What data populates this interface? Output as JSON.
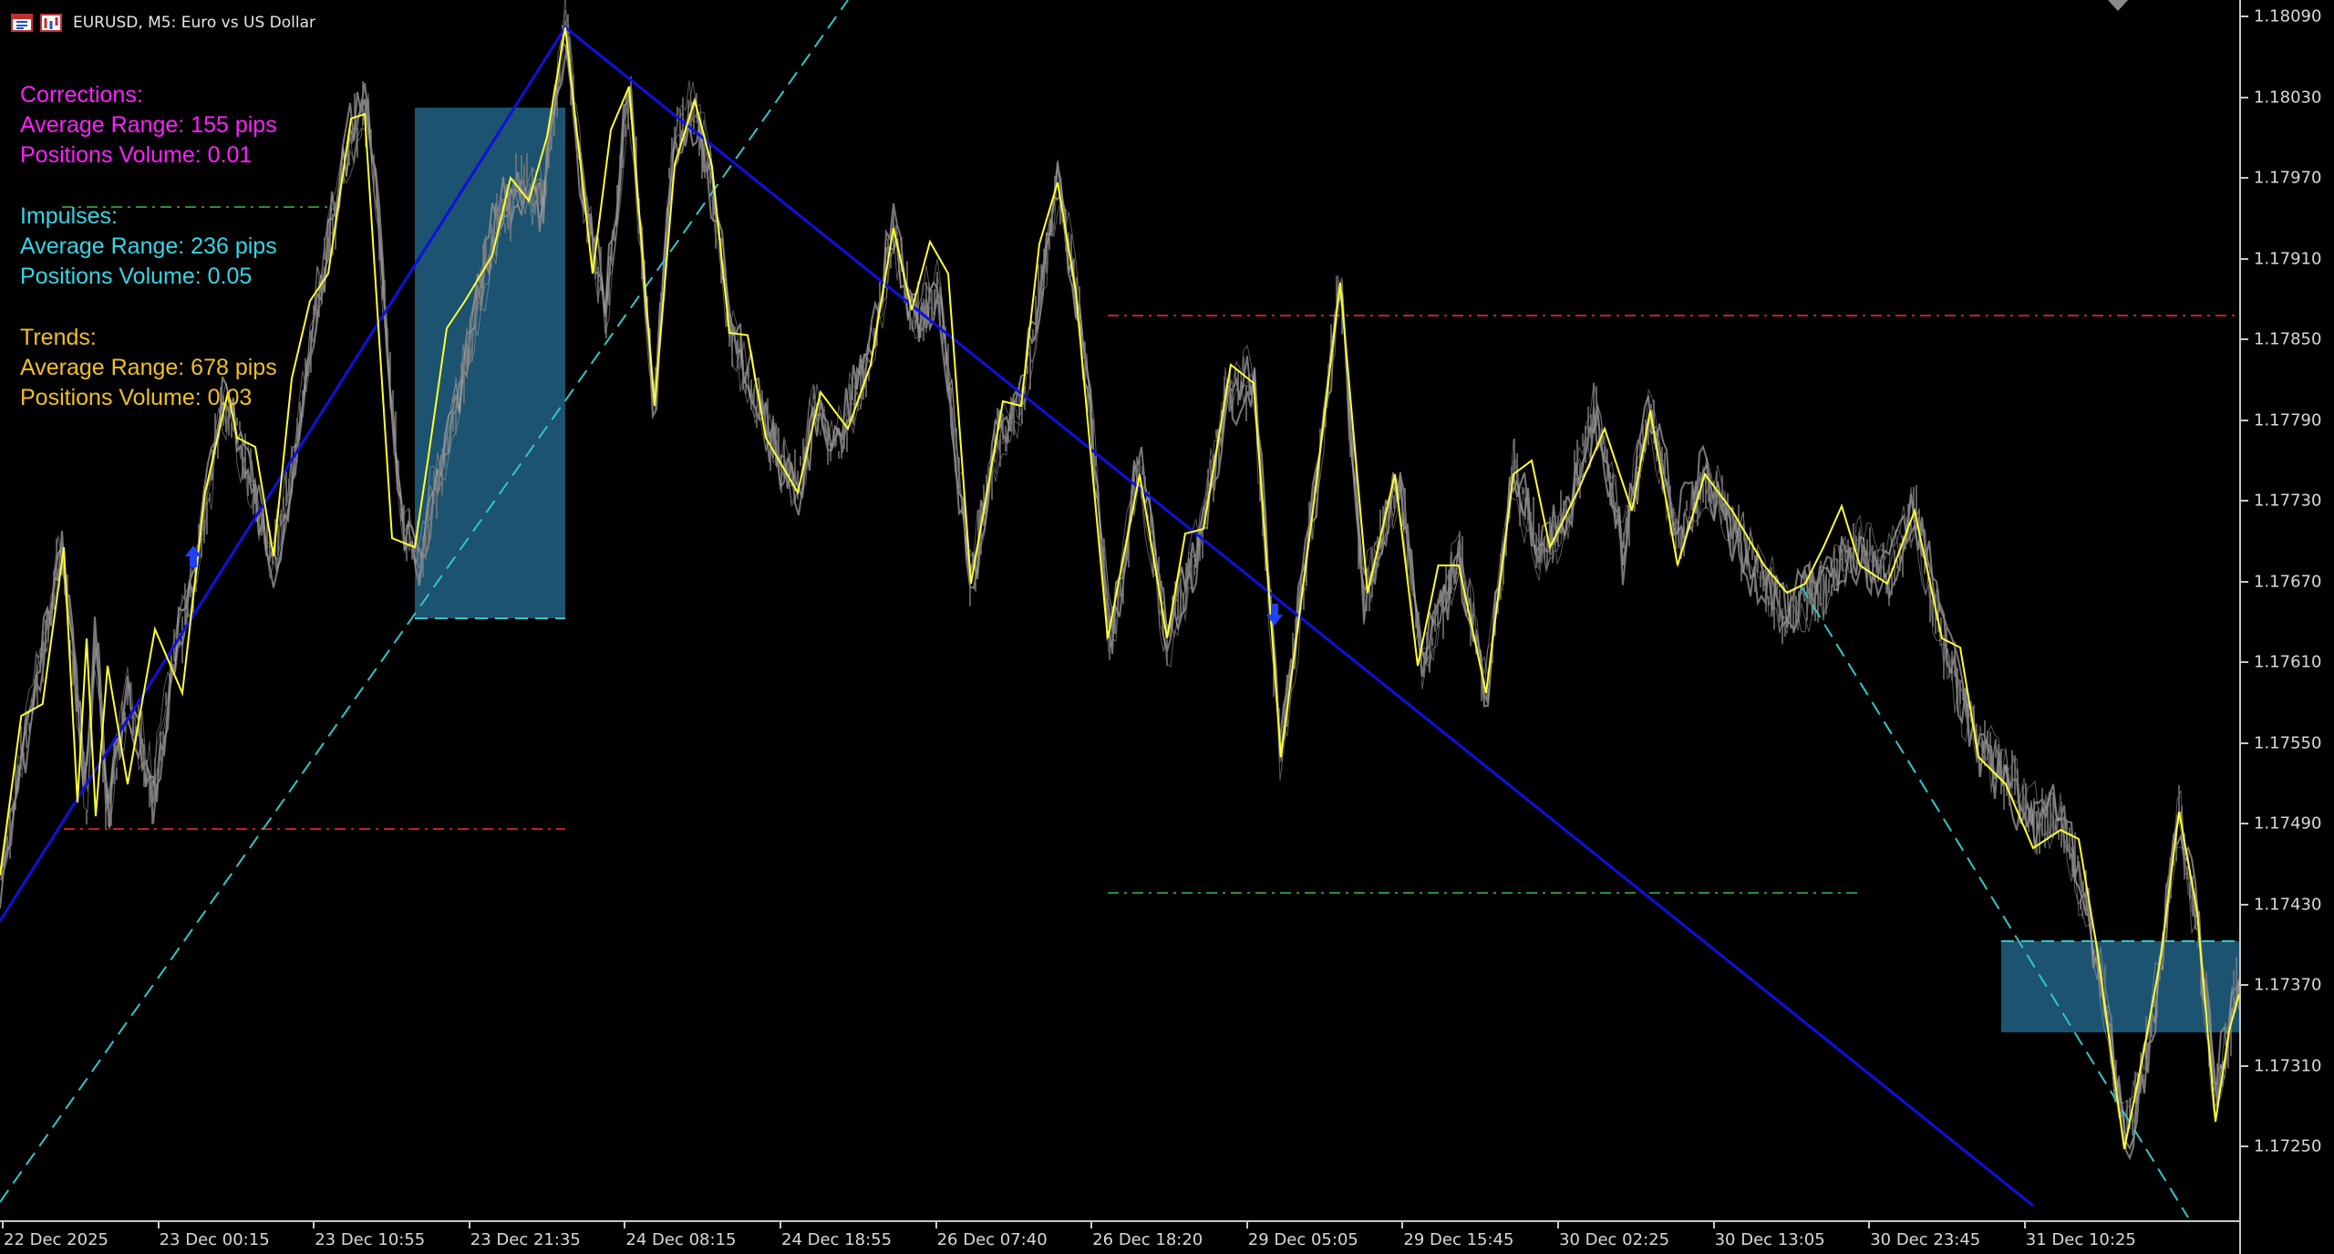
{
  "window": {
    "symbol": "EURUSD",
    "timeframe": "M5",
    "description": "Euro vs US Dollar",
    "title_text": "EURUSD, M5:  Euro vs US Dollar"
  },
  "info_panel": {
    "corrections": {
      "heading": "Corrections:",
      "range": "Average Range: 155 pips",
      "volume": "Positions Volume: 0.01",
      "color": "#ff20ff"
    },
    "impulses": {
      "heading": "Impulses:",
      "range": "Average Range: 236 pips",
      "volume": "Positions Volume: 0.05",
      "color": "#33d6e6"
    },
    "trends": {
      "heading": "Trends:",
      "range": "Average Range: 678 pips",
      "volume": "Positions Volume: 0.03",
      "color": "#f0c020"
    }
  },
  "price_axis": {
    "labels": [
      "1.18090",
      "1.18030",
      "1.17970",
      "1.17910",
      "1.17850",
      "1.17790",
      "1.17730",
      "1.17670",
      "1.17610",
      "1.17550",
      "1.17490",
      "1.17430",
      "1.17370",
      "1.17310",
      "1.17250"
    ]
  },
  "time_axis": {
    "labels": [
      "22 Dec 2025",
      "23 Dec 00:15",
      "23 Dec 10:55",
      "23 Dec 21:35",
      "24 Dec 08:15",
      "24 Dec 18:55",
      "26 Dec 07:40",
      "26 Dec 18:20",
      "29 Dec 05:05",
      "29 Dec 15:45",
      "30 Dec 02:25",
      "30 Dec 13:05",
      "30 Dec 23:45",
      "31 Dec 10:25"
    ]
  },
  "colors": {
    "background": "#000000",
    "zigzag": "#ffff33",
    "trend_line": "#1010e0",
    "channel": "#33c6c6",
    "zone_fill": "#1e5a7a",
    "resistance": "#c02020",
    "support": "#2e8b3a",
    "price_noise": "#8c8c8c",
    "arrow": "#2040ff"
  },
  "icons": {
    "chart_icon": "chart-window-icon",
    "bars_icon": "bars-icon"
  }
}
